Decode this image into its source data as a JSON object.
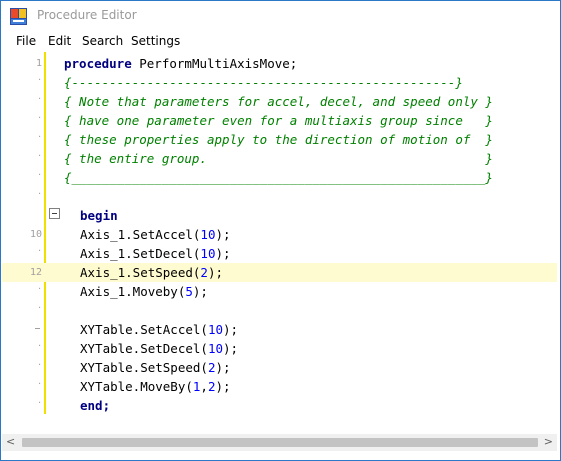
{
  "window": {
    "title": "Procedure Editor",
    "icon": "procedure-editor-app-icon"
  },
  "menu": {
    "items": [
      "File",
      "Edit",
      "Search",
      "Settings"
    ]
  },
  "editor": {
    "current_line": 12,
    "lines": [
      {
        "gutter": "1"
      },
      {
        "gutter": "·"
      },
      {
        "gutter": "·"
      },
      {
        "gutter": "·"
      },
      {
        "gutter": "·"
      },
      {
        "gutter": "·"
      },
      {
        "gutter": "·"
      },
      {
        "gutter": "·"
      },
      {
        "gutter": "·"
      },
      {
        "gutter": "10"
      },
      {
        "gutter": "·"
      },
      {
        "gutter": "12"
      },
      {
        "gutter": "·"
      },
      {
        "gutter": "·"
      },
      {
        "gutter": "–"
      },
      {
        "gutter": "·"
      },
      {
        "gutter": "·"
      },
      {
        "gutter": "·"
      },
      {
        "gutter": "·"
      }
    ],
    "text": {
      "l1_kw": "procedure",
      "l1_name": " PerformMultiAxisMove;",
      "l2": "{---------------------------------------------------}",
      "l3": "{ Note that parameters for accel, decel, and speed only }",
      "l4": "{ have one parameter even for a multiaxis group since   }",
      "l5": "{ these properties apply to the direction of motion of  }",
      "l6": "{ the entire group.                                     }",
      "l7": "{_______________________________________________________}",
      "begin": "begin",
      "end": "end;",
      "l10_a": "Axis_1.SetAccel(",
      "l10_n": "10",
      "l10_b": ");",
      "l11_a": "Axis_1.SetDecel(",
      "l11_n": "10",
      "l11_b": ");",
      "l12_a": "Axis_1.SetSpeed(",
      "l12_n": "2",
      "l12_b": ");",
      "l13_a": "Axis_1.Moveby(",
      "l13_n": "5",
      "l13_b": ");",
      "l15_a": "XYTable.SetAccel(",
      "l15_n": "10",
      "l15_b": ");",
      "l16_a": "XYTable.SetDecel(",
      "l16_n": "10",
      "l16_b": ");",
      "l17_a": "XYTable.SetSpeed(",
      "l17_n": "2",
      "l17_b": ");",
      "l18_a": "XYTable.MoveBy(",
      "l18_n1": "1",
      "l18_c": ",",
      "l18_n2": "2",
      "l18_b": ");"
    }
  },
  "scrollbar": {
    "left_arrow": "<",
    "right_arrow": ">"
  }
}
